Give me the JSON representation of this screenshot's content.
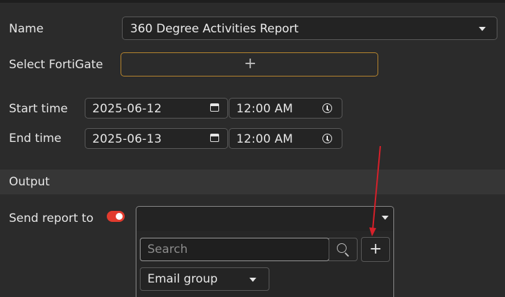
{
  "form": {
    "name_label": "Name",
    "name_value": "360 Degree Activities Report",
    "fortigate_label": "Select FortiGate",
    "fortigate_add_symbol": "+",
    "start_label": "Start time",
    "start_date": "2025-06-12",
    "start_time": "12:00 AM",
    "end_label": "End time",
    "end_date": "2025-06-13",
    "end_time": "12:00 AM"
  },
  "output": {
    "section_title": "Output",
    "send_report_label": "Send report to",
    "send_report_enabled": true,
    "search_placeholder": "Search",
    "add_symbol": "+",
    "recipient_type": "Email group"
  },
  "colors": {
    "toggle_on": "#e23b2e",
    "fortigate_border": "#b8862e",
    "annotation_arrow": "#d8202a"
  }
}
